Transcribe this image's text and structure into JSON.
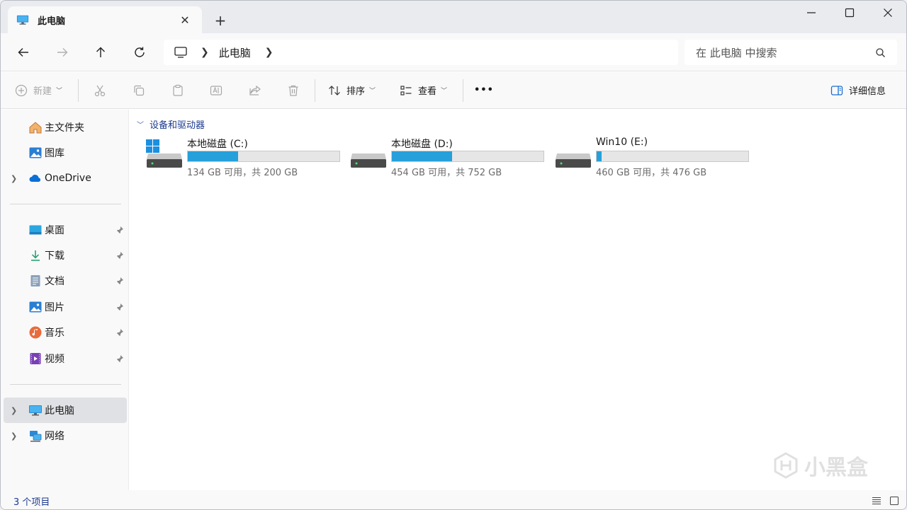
{
  "tab": {
    "title": "此电脑",
    "close_label": "✕"
  },
  "newtab_label": "+",
  "address": {
    "breadcrumb": "此电脑"
  },
  "search": {
    "placeholder": "在 此电脑 中搜索"
  },
  "commandbar": {
    "new_label": "新建",
    "sort_label": "排序",
    "view_label": "查看",
    "more_label": "•••",
    "details_label": "详细信息"
  },
  "sidebar": {
    "quick": [
      {
        "label": "主文件夹",
        "icon": "home-icon"
      },
      {
        "label": "图库",
        "icon": "gallery-icon"
      },
      {
        "label": "OneDrive",
        "icon": "cloud-icon"
      }
    ],
    "pinned": [
      {
        "label": "桌面",
        "icon": "desktop-icon"
      },
      {
        "label": "下载",
        "icon": "download-icon"
      },
      {
        "label": "文档",
        "icon": "document-icon"
      },
      {
        "label": "图片",
        "icon": "pictures-icon"
      },
      {
        "label": "音乐",
        "icon": "music-icon"
      },
      {
        "label": "视频",
        "icon": "video-icon"
      }
    ],
    "system": [
      {
        "label": "此电脑",
        "icon": "computer-icon"
      },
      {
        "label": "网络",
        "icon": "network-icon"
      }
    ]
  },
  "content": {
    "group_title": "设备和驱动器",
    "drives": [
      {
        "name": "本地磁盘 (C:)",
        "info": "134 GB 可用，共 200 GB",
        "used_fraction": 0.33
      },
      {
        "name": "本地磁盘 (D:)",
        "info": "454 GB 可用，共 752 GB",
        "used_fraction": 0.396
      },
      {
        "name": "Win10 (E:)",
        "info": "460 GB 可用，共 476 GB",
        "used_fraction": 0.034
      }
    ]
  },
  "status": {
    "count": "3 个项目"
  },
  "watermark_text": "小黑盒",
  "colors": {
    "accent": "#26a0da",
    "link": "#1d3b8f",
    "selected": "#e0e1e4"
  }
}
